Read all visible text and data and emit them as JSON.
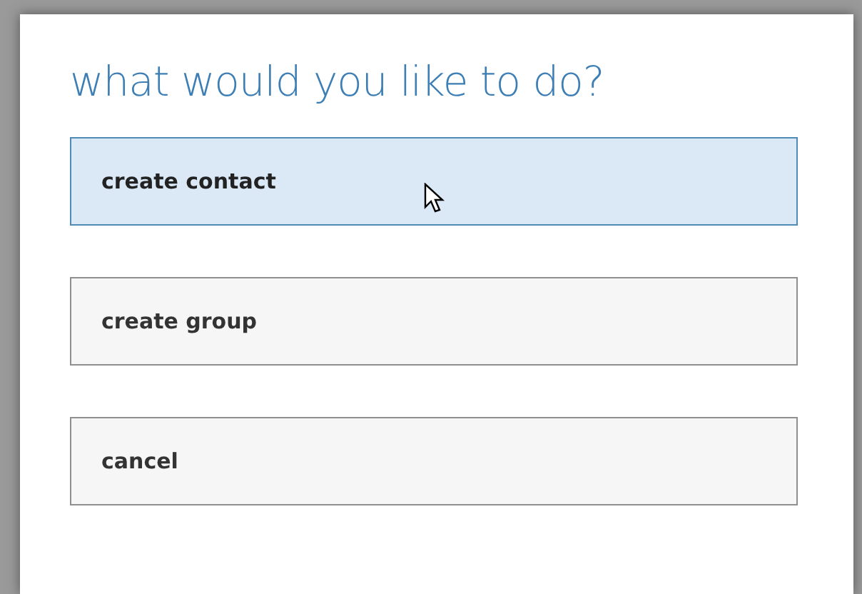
{
  "dialog": {
    "title": "what would you like to do?",
    "buttons": [
      {
        "label": "create contact",
        "hovered": true
      },
      {
        "label": "create group",
        "hovered": false
      },
      {
        "label": "cancel",
        "hovered": false
      }
    ]
  }
}
